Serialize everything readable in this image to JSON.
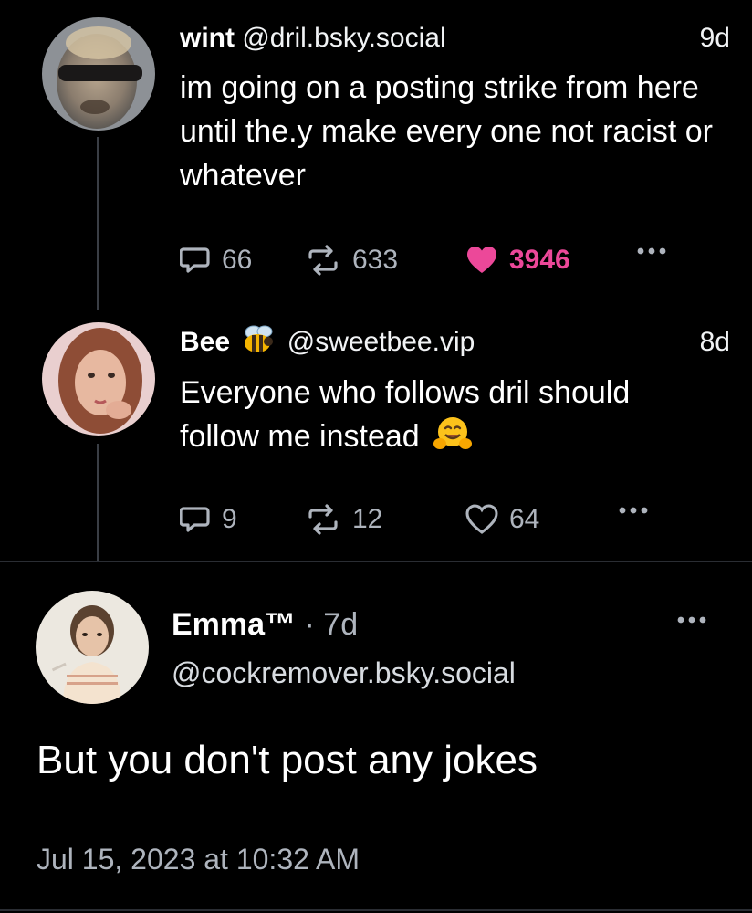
{
  "colors": {
    "background": "#000000",
    "muted": "#aeb4bd",
    "like_active": "#ec4899",
    "thread_line": "#3a3e45"
  },
  "posts": [
    {
      "name": "wint",
      "handle": "@dril.bsky.social",
      "time": "9d",
      "body": "im going on a posting strike from here until the.y make every one not racist or whatever",
      "replies": "66",
      "reposts": "633",
      "likes": "3946",
      "liked": true
    },
    {
      "name": "Bee",
      "name_emoji": "bee-emoji",
      "handle": "@sweetbee.vip",
      "time": "8d",
      "body": "Everyone who follows dril should follow me instead",
      "body_emoji": "hugging-face-emoji",
      "replies": "9",
      "reposts": "12",
      "likes": "64",
      "liked": false
    }
  ],
  "focused": {
    "name": "Emma™",
    "separator": "·",
    "time": "7d",
    "handle": "@cockremover.bsky.social",
    "body": "But you don't post any jokes",
    "date": "Jul 15, 2023 at 10:32 AM"
  },
  "icons": {
    "reply": "speech-bubble-icon",
    "repost": "repost-arrows-icon",
    "like": "heart-icon",
    "more": "ellipsis-icon"
  }
}
